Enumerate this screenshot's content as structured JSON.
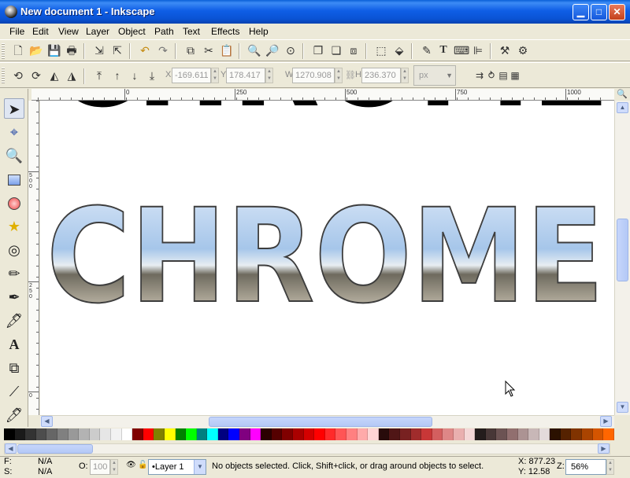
{
  "window": {
    "title": "New document 1 - Inkscape",
    "minimize_glyph": "▁",
    "maximize_glyph": "□",
    "close_glyph": "✕"
  },
  "menu": [
    "File",
    "Edit",
    "View",
    "Layer",
    "Object",
    "Path",
    "Text",
    "Effects",
    "Help"
  ],
  "command_bar": {
    "icons": [
      "new-icon",
      "open-icon",
      "save-icon",
      "print-icon",
      "import-icon",
      "export-icon",
      "undo-icon",
      "redo-icon",
      "copy-icon",
      "cut-icon",
      "paste-icon",
      "zoom-selection-icon",
      "zoom-drawing-icon",
      "zoom-page-icon",
      "duplicate-icon",
      "clone-icon",
      "unlink-clone-icon",
      "group-icon",
      "ungroup-icon",
      "fill-stroke-icon",
      "text-font-icon",
      "xml-editor-icon",
      "align-icon",
      "preferences-icon",
      "document-properties-icon"
    ]
  },
  "selector_toolbar": {
    "x_label": "X",
    "x_value": "-169.611",
    "y_label": "Y",
    "y_value": "178.417",
    "w_label": "W",
    "w_value": "1270.908",
    "h_label": "H",
    "h_value": "236.370",
    "unit": "px"
  },
  "ruler": {
    "h_labels": [
      "0",
      "250",
      "500",
      "750",
      "1000"
    ],
    "v_labels": [
      "500",
      "250",
      "0"
    ]
  },
  "canvas": {
    "text": "CHROME"
  },
  "toolbox": {
    "tools": [
      "selector-tool-icon",
      "node-tool-icon",
      "zoom-tool-icon",
      "rectangle-tool-icon",
      "ellipse-tool-icon",
      "star-tool-icon",
      "spiral-tool-icon",
      "pencil-tool-icon",
      "pen-tool-icon",
      "calligraphy-tool-icon",
      "text-tool-icon",
      "gradient-tool-icon",
      "connector-tool-icon",
      "dropper-tool-icon"
    ]
  },
  "palette": {
    "colors": [
      "#000000",
      "#1a1a1a",
      "#333333",
      "#4d4d4d",
      "#666666",
      "#808080",
      "#999999",
      "#b3b3b3",
      "#cccccc",
      "#e6e6e6",
      "#f2f2f2",
      "#ffffff",
      "#800000",
      "#ff0000",
      "#808000",
      "#ffff00",
      "#008000",
      "#00ff00",
      "#008080",
      "#00ffff",
      "#000080",
      "#0000ff",
      "#800080",
      "#ff00ff",
      "#2b0000",
      "#550000",
      "#800000",
      "#aa0000",
      "#d40000",
      "#ff0000",
      "#ff2a2a",
      "#ff5555",
      "#ff8080",
      "#ffaaaa",
      "#ffd5d5",
      "#280b0b",
      "#501616",
      "#782121",
      "#a02c2c",
      "#c83737",
      "#d35f5f",
      "#de8787",
      "#e9afaf",
      "#f4d7d7",
      "#241c1c",
      "#483737",
      "#6c5353",
      "#916f6f",
      "#ac9393",
      "#c8b7b7",
      "#e3dbdb",
      "#2b1100",
      "#552200",
      "#803300",
      "#aa4400",
      "#d45500",
      "#ff6600"
    ]
  },
  "statusbar": {
    "fill_label": "F:",
    "fill_value": "N/A",
    "stroke_label": "S:",
    "stroke_value": "N/A",
    "opacity_label": "O:",
    "opacity_value": "100",
    "layer": "•Layer 1",
    "message": "No objects selected. Click, Shift+click, or drag around objects to select.",
    "x_coord": "X: 877.23",
    "y_coord": "Y: 12.58",
    "zoom_label": "Z:",
    "zoom_value": "56%"
  }
}
